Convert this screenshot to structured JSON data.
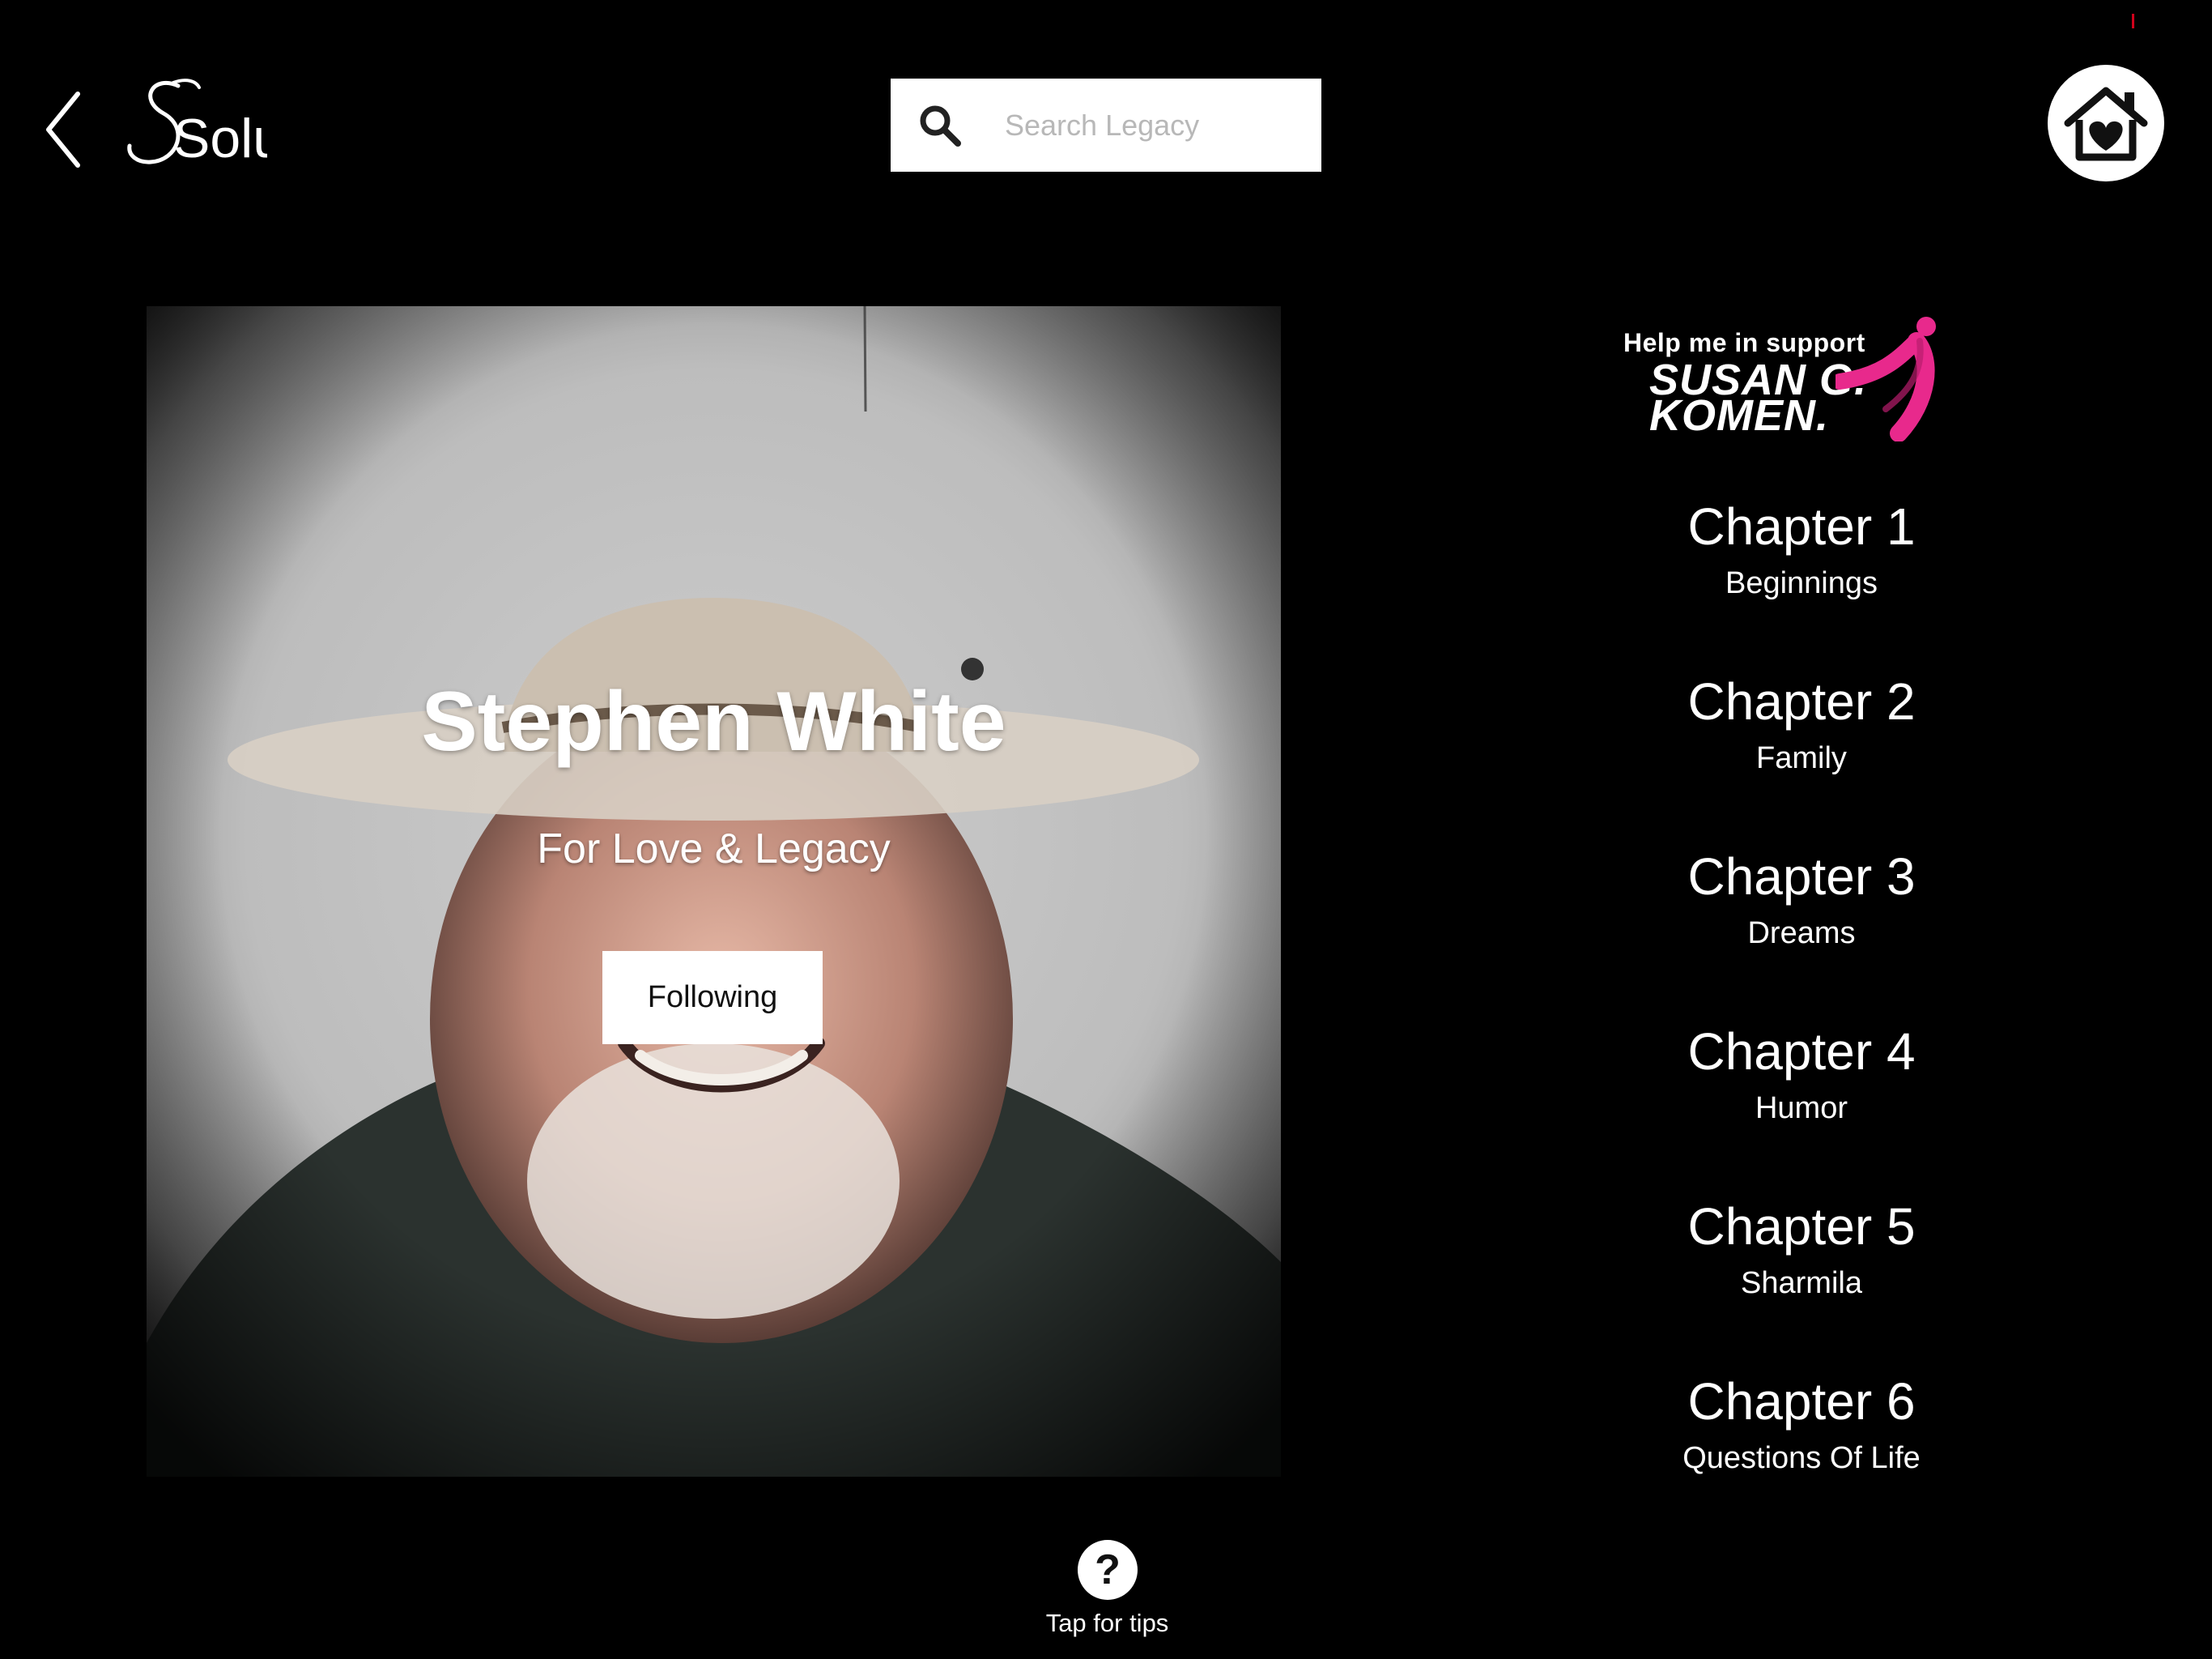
{
  "header": {
    "logo_text": "Solu",
    "search": {
      "placeholder": "Search Legacy",
      "value": ""
    }
  },
  "hero": {
    "name": "Stephen White",
    "subtitle": "For Love & Legacy",
    "follow_label": "Following"
  },
  "sponsor": {
    "tagline": "Help me in support",
    "org_line1": "SUSAN G.",
    "org_line2": "KOMEN."
  },
  "chapters": [
    {
      "title": "Chapter 1",
      "subtitle": "Beginnings"
    },
    {
      "title": "Chapter 2",
      "subtitle": "Family"
    },
    {
      "title": "Chapter 3",
      "subtitle": "Dreams"
    },
    {
      "title": "Chapter 4",
      "subtitle": "Humor"
    },
    {
      "title": "Chapter 5",
      "subtitle": "Sharmila"
    },
    {
      "title": "Chapter 6",
      "subtitle": "Questions Of Life"
    }
  ],
  "footer": {
    "tips_label": "Tap for tips"
  },
  "colors": {
    "background": "#000000",
    "ribbon": "#e8298c",
    "accent_red": "#d0021b"
  }
}
